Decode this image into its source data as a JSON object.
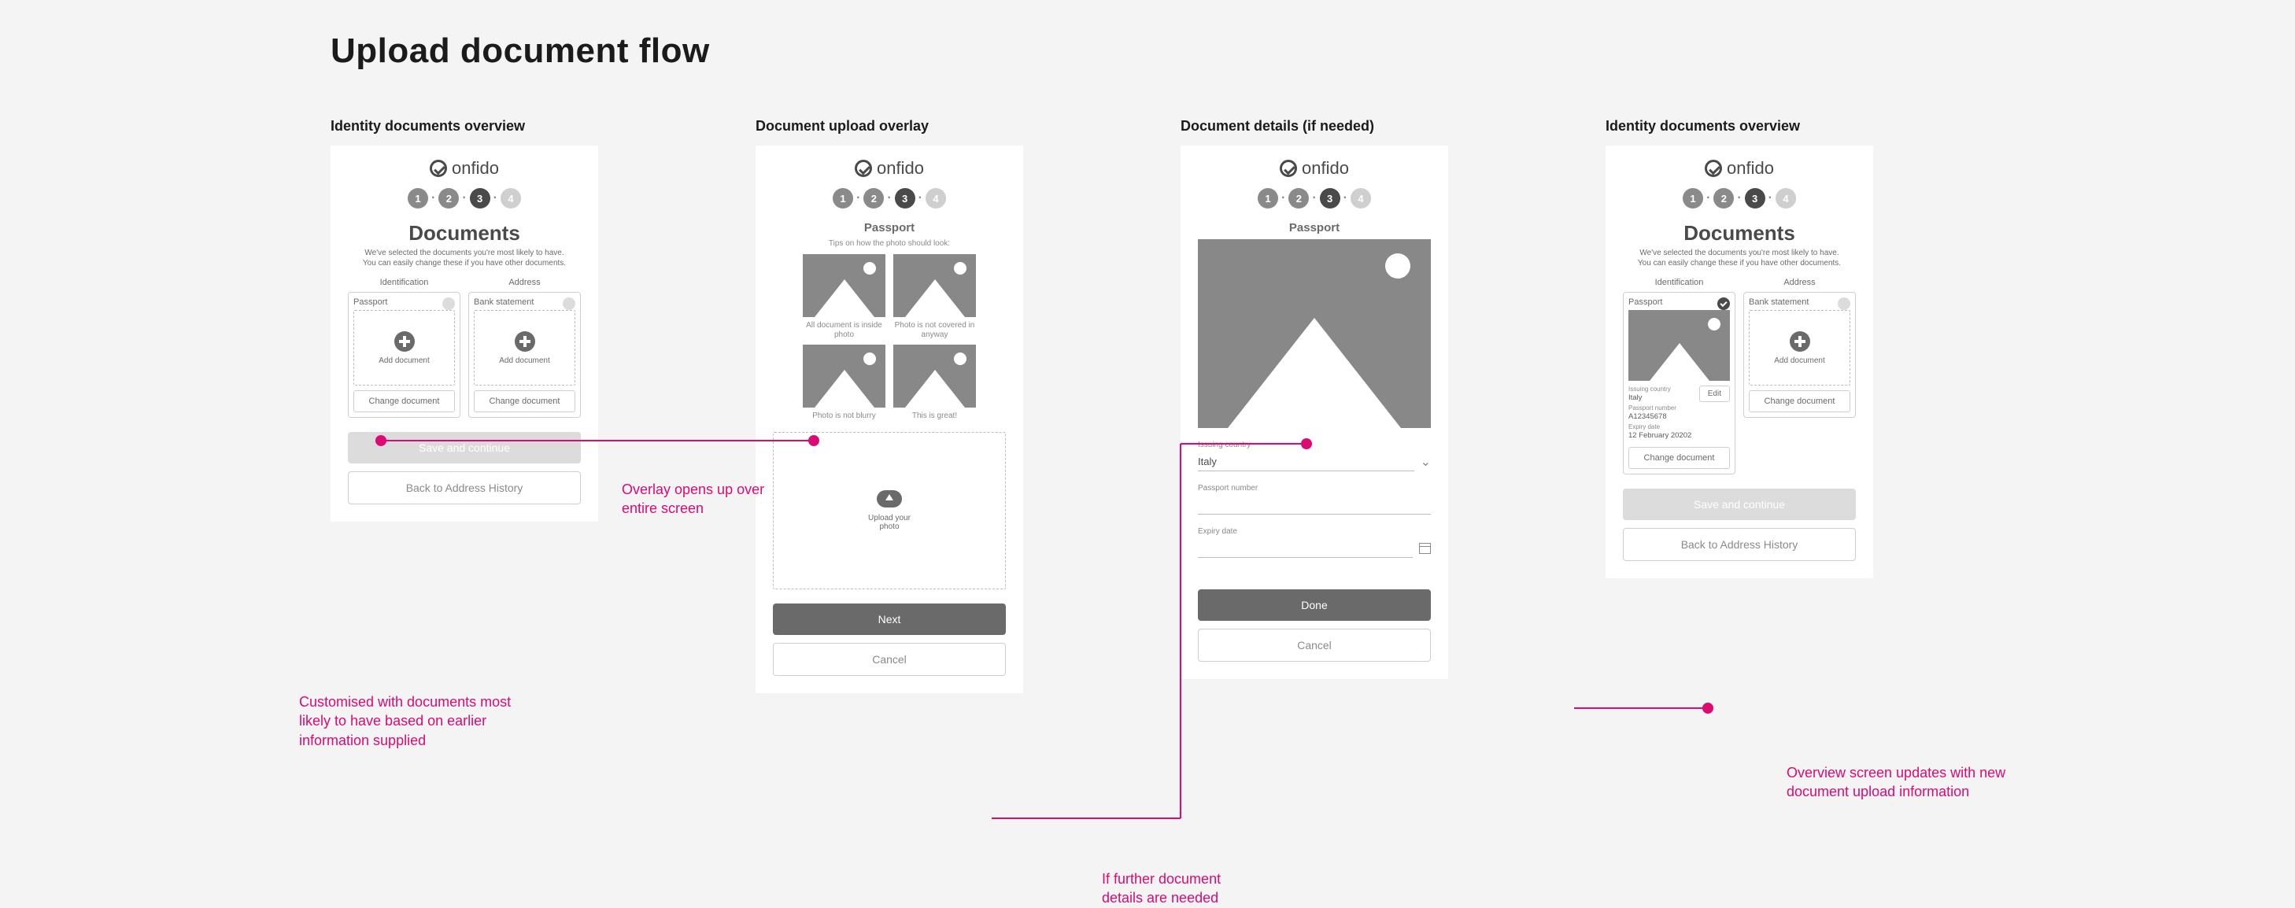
{
  "page_title": "Upload document flow",
  "logo_text": "onfido",
  "steps": [
    "1",
    "2",
    "3",
    "4"
  ],
  "active_step_index": 2,
  "columns": [
    {
      "label": "Identity documents overview",
      "title": "Documents",
      "subtitle_line1": "We've selected the documents you're most likely to have.",
      "subtitle_line2": "You can easily change these if you have other documents.",
      "id_label": "Identification",
      "addr_label": "Address",
      "passport_label": "Passport",
      "bank_label": "Bank statement",
      "add_doc": "Add document",
      "change_doc": "Change document",
      "save_btn": "Save and continue",
      "back_btn": "Back to Address History"
    },
    {
      "label": "Document upload overlay",
      "section": "Passport",
      "tips_intro": "Tips on how the photo should look:",
      "tips": [
        "All document is inside photo",
        "Photo is not covered in anyway",
        "Photo is not blurry",
        "This is great!"
      ],
      "dropzone_text": "Upload your photo",
      "next_btn": "Next",
      "cancel_btn": "Cancel"
    },
    {
      "label": "Document details (if needed)",
      "section": "Passport",
      "issuing_country_label": "Issuing country",
      "issuing_country_value": "Italy",
      "passport_number_label": "Passport number",
      "expiry_date_label": "Expiry date",
      "done_btn": "Done",
      "cancel_btn": "Cancel"
    },
    {
      "label": "Identity documents overview",
      "title": "Documents",
      "subtitle_line1": "We've selected the documents you're most likely to have.",
      "subtitle_line2": "You can easily change these if you have other documents.",
      "id_label": "Identification",
      "addr_label": "Address",
      "passport_label": "Passport",
      "bank_label": "Bank statement",
      "add_doc": "Add document",
      "change_doc": "Change document",
      "edit_btn": "Edit",
      "meta": {
        "issuing_country_lab": "Issuing country",
        "issuing_country_val": "Italy",
        "passport_number_lab": "Passport number",
        "passport_number_val": "A12345678",
        "expiry_lab": "Expiry date",
        "expiry_val": "12 February 20202"
      },
      "save_btn": "Save and continue",
      "back_btn": "Back to Address History"
    }
  ],
  "annotations": {
    "a1": "Customised with documents most likely to have based on earlier information supplied",
    "a2": "Overlay opens up over entire screen",
    "a3": "If further document details are needed",
    "a4": "Overview screen updates with new document upload information"
  }
}
